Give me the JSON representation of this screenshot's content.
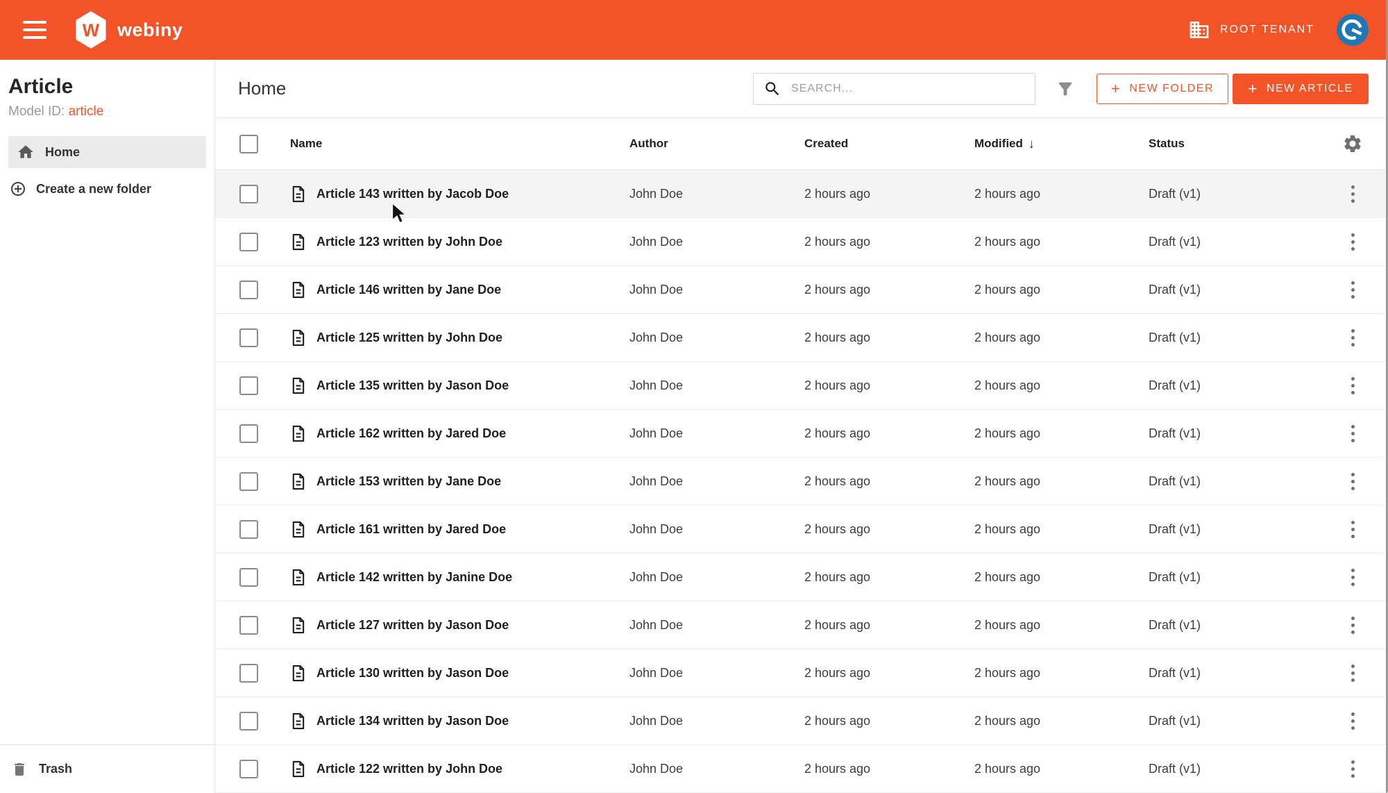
{
  "colors": {
    "brand": "#F25428",
    "avatar_blue": "#1f78b4",
    "hover_row": "#f4f4f4"
  },
  "icons": {
    "menu": "hamburger-icon",
    "logo": "webiny-hexagon-logo",
    "tenant": "building-icon",
    "account": "power-avatar-icon",
    "home": "home-icon",
    "create_folder": "circle-plus-icon",
    "trash": "trash-icon",
    "search": "search-icon",
    "filter": "funnel-icon",
    "settings": "gear-icon",
    "file": "document-icon",
    "row_menu": "kebab-icon",
    "plus": "+",
    "sort_desc_arrow": "↓"
  },
  "brand": {
    "name": "webiny",
    "logo_letter": "W"
  },
  "header": {
    "tenant_label": "ROOT TENANT"
  },
  "sidebar": {
    "title": "Article",
    "model_id_label": "Model ID:",
    "model_id_value": "article",
    "items": [
      {
        "label": "Home",
        "selected": true
      }
    ],
    "create_folder_label": "Create a new folder",
    "trash_label": "Trash"
  },
  "toolbar": {
    "title": "Home",
    "search_placeholder": "SEARCH...",
    "new_folder_label": "NEW FOLDER",
    "new_article_label": "NEW ARTICLE"
  },
  "table": {
    "columns": [
      "Name",
      "Author",
      "Created",
      "Modified",
      "Status"
    ],
    "sorted_by": "Modified",
    "sort_direction": "desc",
    "sort_arrow": "↓",
    "rows": [
      {
        "name": "Article 143 written by Jacob Doe",
        "author": "John Doe",
        "created": "2 hours ago",
        "modified": "2 hours ago",
        "status": "Draft (v1)",
        "hovered": true
      },
      {
        "name": "Article 123 written by John Doe",
        "author": "John Doe",
        "created": "2 hours ago",
        "modified": "2 hours ago",
        "status": "Draft (v1)"
      },
      {
        "name": "Article 146 written by Jane Doe",
        "author": "John Doe",
        "created": "2 hours ago",
        "modified": "2 hours ago",
        "status": "Draft (v1)"
      },
      {
        "name": "Article 125 written by John Doe",
        "author": "John Doe",
        "created": "2 hours ago",
        "modified": "2 hours ago",
        "status": "Draft (v1)"
      },
      {
        "name": "Article 135 written by Jason Doe",
        "author": "John Doe",
        "created": "2 hours ago",
        "modified": "2 hours ago",
        "status": "Draft (v1)"
      },
      {
        "name": "Article 162 written by Jared Doe",
        "author": "John Doe",
        "created": "2 hours ago",
        "modified": "2 hours ago",
        "status": "Draft (v1)"
      },
      {
        "name": "Article 153 written by Jane Doe",
        "author": "John Doe",
        "created": "2 hours ago",
        "modified": "2 hours ago",
        "status": "Draft (v1)"
      },
      {
        "name": "Article 161 written by Jared Doe",
        "author": "John Doe",
        "created": "2 hours ago",
        "modified": "2 hours ago",
        "status": "Draft (v1)"
      },
      {
        "name": "Article 142 written by Janine Doe",
        "author": "John Doe",
        "created": "2 hours ago",
        "modified": "2 hours ago",
        "status": "Draft (v1)"
      },
      {
        "name": "Article 127 written by Jason Doe",
        "author": "John Doe",
        "created": "2 hours ago",
        "modified": "2 hours ago",
        "status": "Draft (v1)"
      },
      {
        "name": "Article 130 written by Jason Doe",
        "author": "John Doe",
        "created": "2 hours ago",
        "modified": "2 hours ago",
        "status": "Draft (v1)"
      },
      {
        "name": "Article 134 written by Jason Doe",
        "author": "John Doe",
        "created": "2 hours ago",
        "modified": "2 hours ago",
        "status": "Draft (v1)"
      },
      {
        "name": "Article 122 written by John Doe",
        "author": "John Doe",
        "created": "2 hours ago",
        "modified": "2 hours ago",
        "status": "Draft (v1)"
      }
    ]
  }
}
